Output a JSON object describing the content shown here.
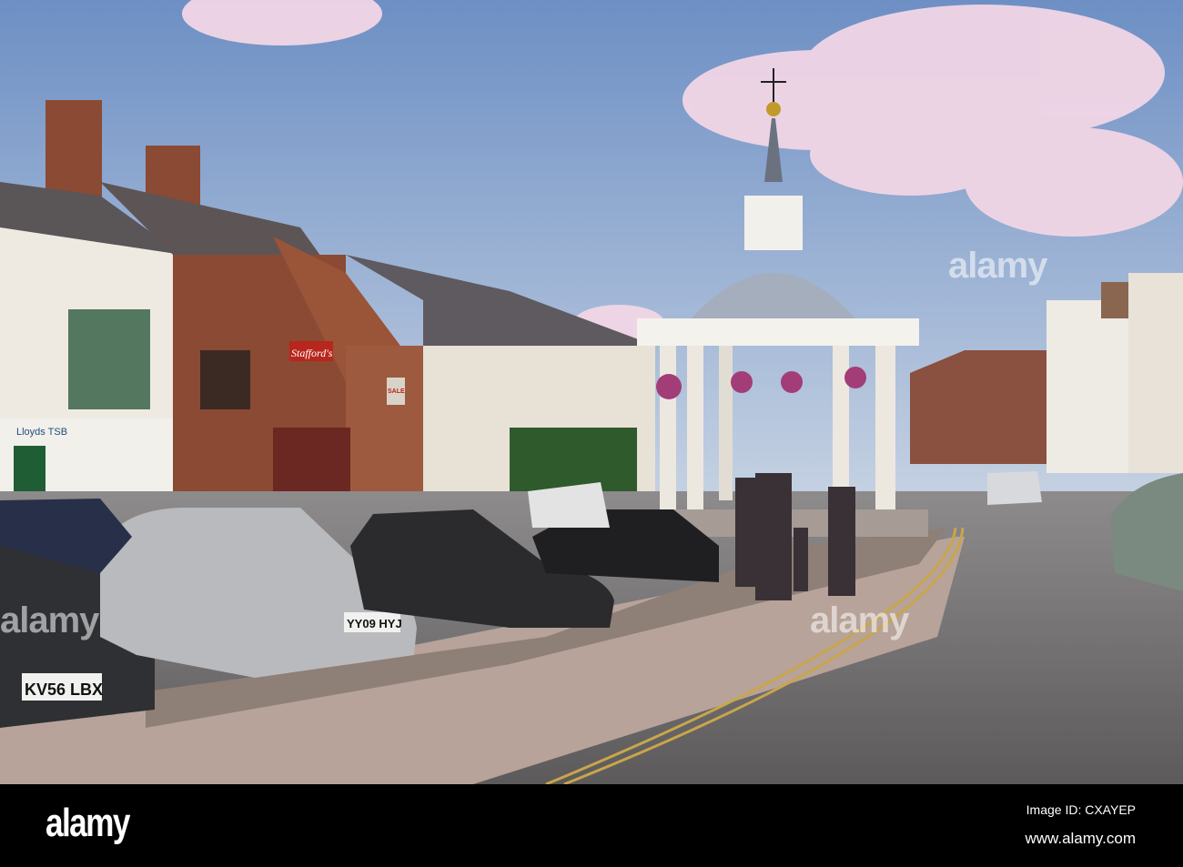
{
  "watermark": {
    "text": "alamy"
  },
  "footer": {
    "logo": "alamy",
    "image_id": "Image ID: CXAYEP",
    "website": "www.alamy.com"
  },
  "scene": {
    "signs": {
      "bank": "Lloyds TSB",
      "shop": "Stafford's",
      "sale": "SALE"
    },
    "plates": {
      "renault": "KV56 LBX",
      "citroen": "YY09 HYJ"
    }
  },
  "colors": {
    "sky_top": "#6d8fc4",
    "sky_bottom": "#c7d3e3",
    "cloud": "#f1d6e6",
    "brick": "#8a4a33",
    "footer": "#000000"
  }
}
